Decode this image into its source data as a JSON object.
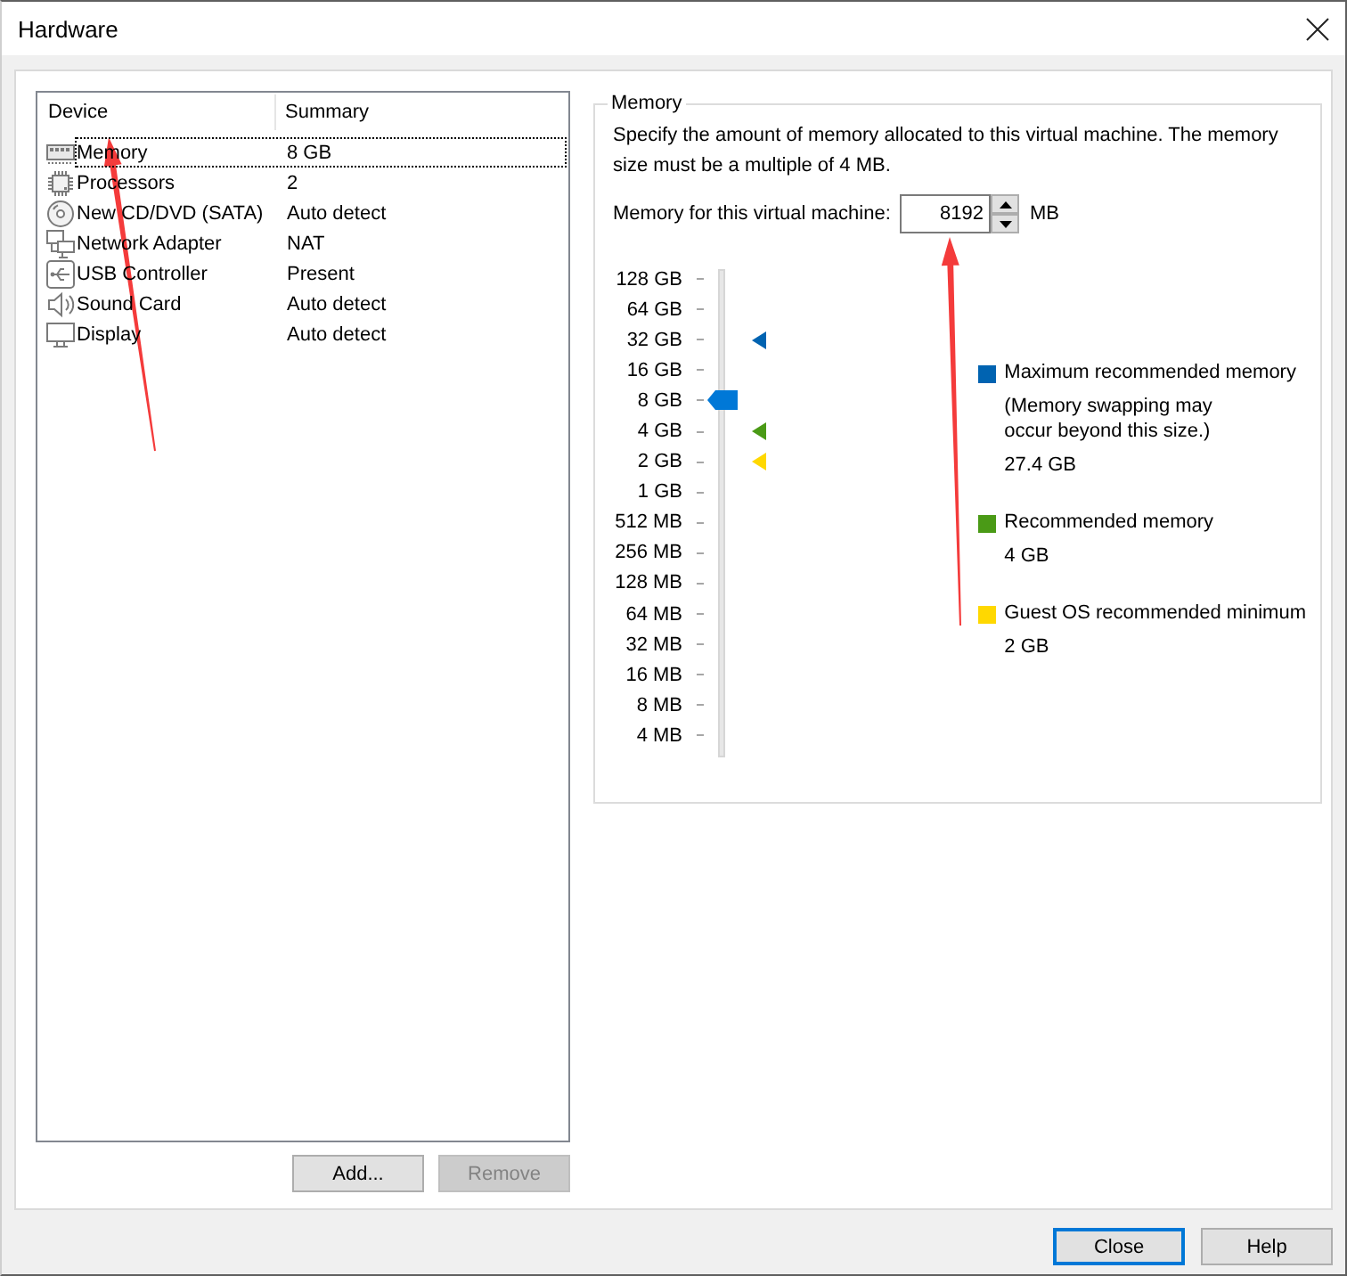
{
  "window": {
    "title": "Hardware"
  },
  "device_list": {
    "columns": [
      "Device",
      "Summary"
    ],
    "rows": [
      {
        "kind": "memory",
        "device": "Memory",
        "summary": "8 GB",
        "selected": true
      },
      {
        "kind": "processor",
        "device": "Processors",
        "summary": "2",
        "selected": false
      },
      {
        "kind": "cd",
        "device": "New CD/DVD (SATA)",
        "summary": "Auto detect",
        "selected": false
      },
      {
        "kind": "network",
        "device": "Network Adapter",
        "summary": "NAT",
        "selected": false
      },
      {
        "kind": "usb",
        "device": "USB Controller",
        "summary": "Present",
        "selected": false
      },
      {
        "kind": "sound",
        "device": "Sound Card",
        "summary": "Auto detect",
        "selected": false
      },
      {
        "kind": "display",
        "device": "Display",
        "summary": "Auto detect",
        "selected": false
      }
    ]
  },
  "list_buttons": [
    {
      "label": "Add...",
      "disabled": false
    },
    {
      "label": "Remove",
      "disabled": true
    }
  ],
  "memory": {
    "title": "Memory",
    "description": "Specify the amount of memory allocated to this virtual machine. The memory size must be a multiple of 4 MB.",
    "field_label": "Memory for this virtual machine:",
    "value": "8192",
    "unit": "MB",
    "slider": {
      "level": 0.7333,
      "ticks": [
        {
          "label": "128 GB",
          "kind": "plain"
        },
        {
          "label": "64 GB",
          "kind": "plain"
        },
        {
          "label": "32 GB",
          "kind": "maximum"
        },
        {
          "label": "16 GB",
          "kind": "plain"
        },
        {
          "label": "8 GB",
          "kind": "plain"
        },
        {
          "label": "4 GB",
          "kind": "recommended"
        },
        {
          "label": "2 GB",
          "kind": "minimum"
        },
        {
          "label": "1 GB",
          "kind": "plain"
        },
        {
          "label": "512 MB",
          "kind": "plain"
        },
        {
          "label": "256 MB",
          "kind": "plain"
        },
        {
          "label": "128 MB",
          "kind": "plain"
        },
        {
          "label": "64 MB",
          "kind": "plain"
        },
        {
          "label": "32 MB",
          "kind": "plain"
        },
        {
          "label": "16 MB",
          "kind": "plain"
        },
        {
          "label": "8 MB",
          "kind": "plain"
        },
        {
          "label": "4 MB",
          "kind": "plain"
        }
      ]
    },
    "legend": [
      {
        "kind": "maximum",
        "color": "#0063b1",
        "label": "Maximum recommended memory",
        "note": "(Memory swapping may occur beyond this size.)",
        "value": "27.4 GB"
      },
      {
        "kind": "recommended",
        "color": "#4a9a16",
        "label": "Recommended memory",
        "value": "4 GB"
      },
      {
        "kind": "minimum",
        "color": "#ffd800",
        "label": "Guest OS recommended minimum",
        "value": "2 GB"
      }
    ]
  },
  "footer_buttons": [
    {
      "label": "Close",
      "default": true
    },
    {
      "label": "Help",
      "default": false
    }
  ]
}
